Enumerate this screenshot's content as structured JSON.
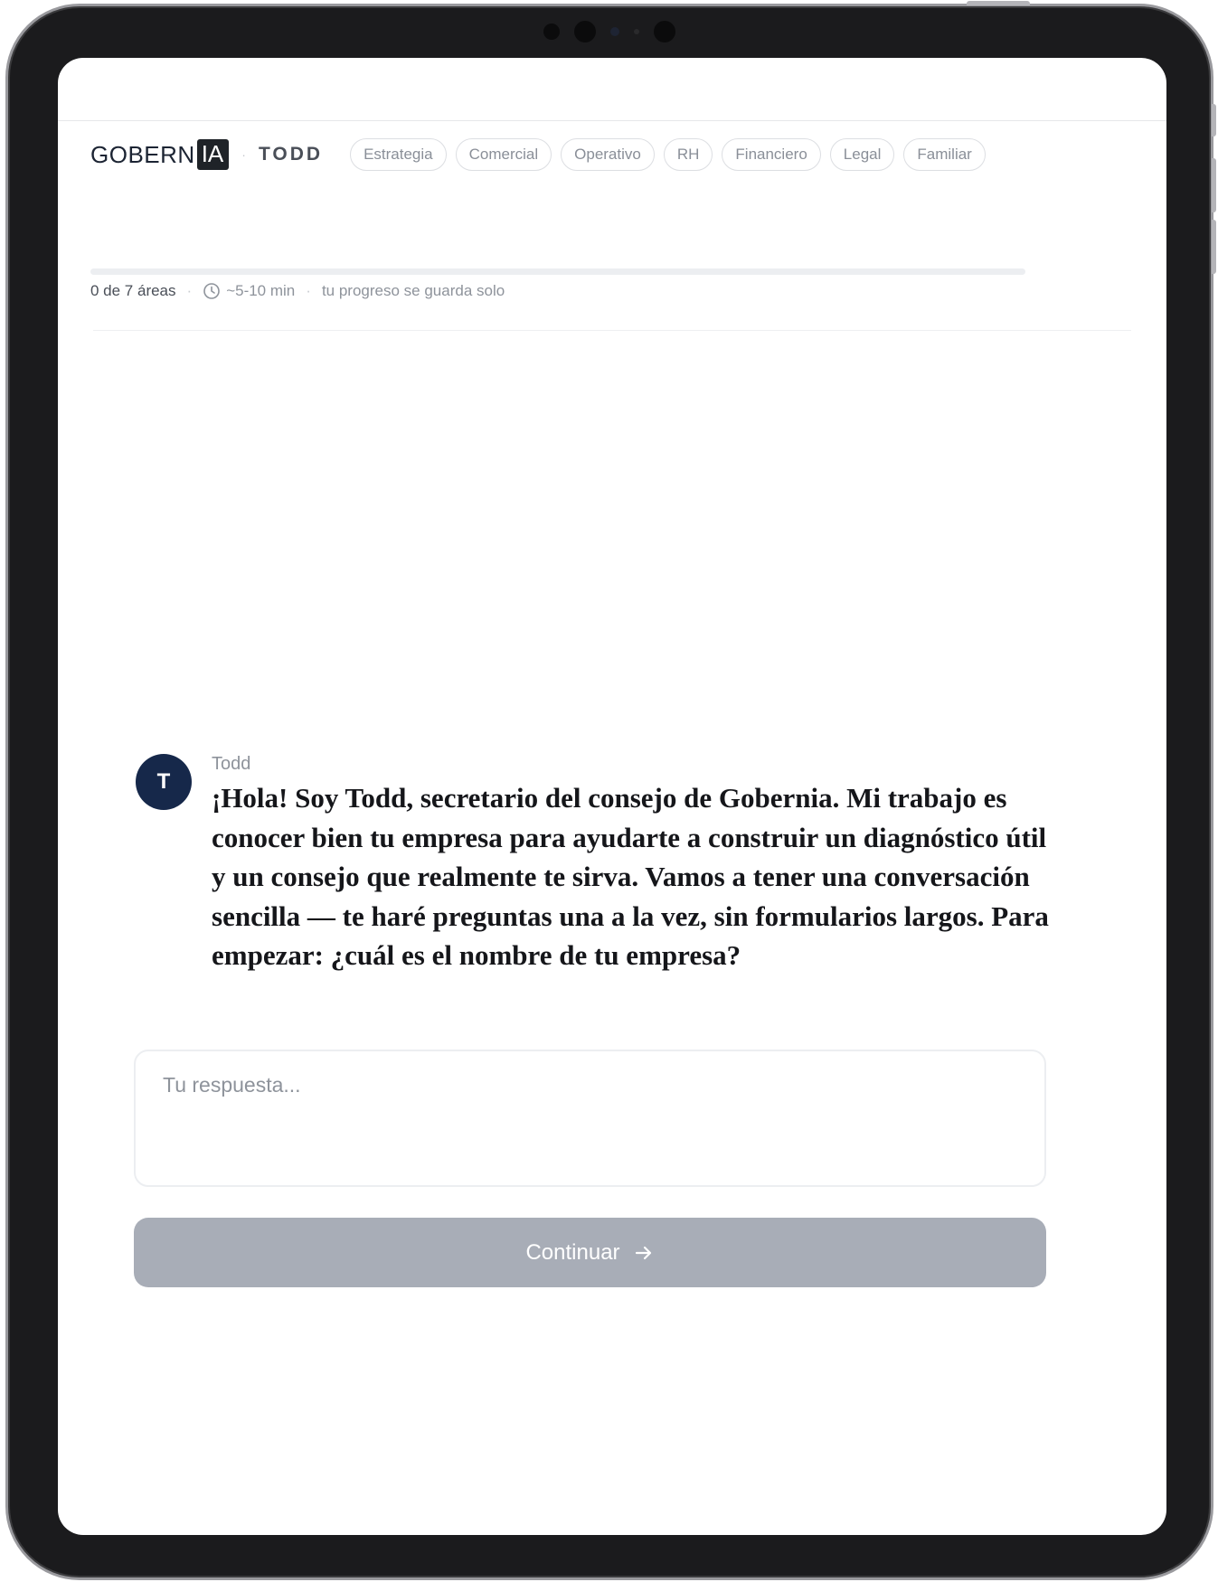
{
  "brand": {
    "logo_text": "GOBERN",
    "logo_box": "IA"
  },
  "assistant": {
    "name": "TODD"
  },
  "areas": [
    {
      "label": "Estrategia"
    },
    {
      "label": "Comercial"
    },
    {
      "label": "Operativo"
    },
    {
      "label": "RH"
    },
    {
      "label": "Financiero"
    },
    {
      "label": "Legal"
    },
    {
      "label": "Familiar"
    }
  ],
  "progress": {
    "fraction": 0,
    "areas_text": "0 de 7 áreas",
    "time_text": "~5-10 min",
    "save_text": "tu progreso se guarda solo"
  },
  "message": {
    "avatar_initial": "T",
    "sender": "Todd",
    "text": "¡Hola! Soy Todd, secretario del consejo de Gobernia. Mi trabajo es conocer bien tu empresa para ayudarte a construir un diagnóstico útil y un consejo que realmente te sirva. Vamos a tener una conversación sencilla — te haré preguntas una a la vez, sin formularios largos. Para empezar: ¿cuál es el nombre de tu empresa?"
  },
  "answer": {
    "placeholder": "Tu respuesta...",
    "value": ""
  },
  "continue_button": {
    "label": "Continuar",
    "icon": "arrow-right-icon"
  },
  "colors": {
    "accent": "#16284a",
    "button_disabled": "#a8adb7"
  }
}
